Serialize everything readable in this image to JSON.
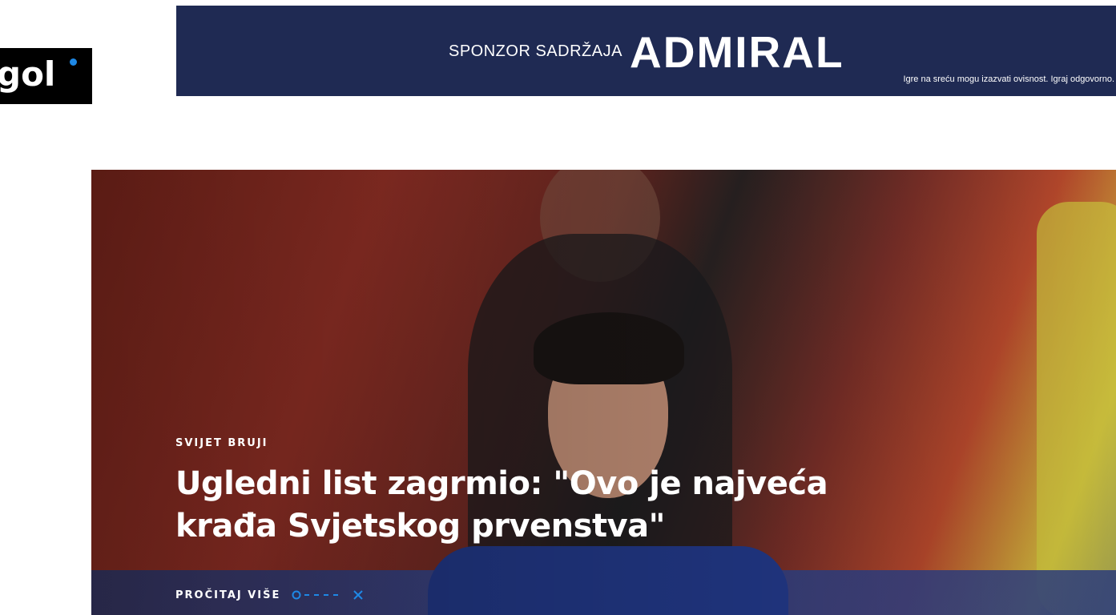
{
  "header": {
    "logo_text": "gol",
    "logo_dot_color": "#1e88e5"
  },
  "banner": {
    "sponsor_label": "SPONZOR SADRŽAJA",
    "brand": "ADMIRAL",
    "disclaimer": "Igre na sreću mogu izazvati ovisnost. Igraj odgovorno.",
    "background_color": "#1f2a53"
  },
  "hero": {
    "category": "SVIJET BRUJI",
    "headline_line1": "Ugledni list zagrmio: \"Ovo je najveća",
    "headline_line2": "krađa Svjetskog prvenstva\"",
    "read_more": "PROČITAJ VIŠE",
    "accent_color": "#1e88e5",
    "read_more_icon": "circle-dashes-x-icon"
  }
}
